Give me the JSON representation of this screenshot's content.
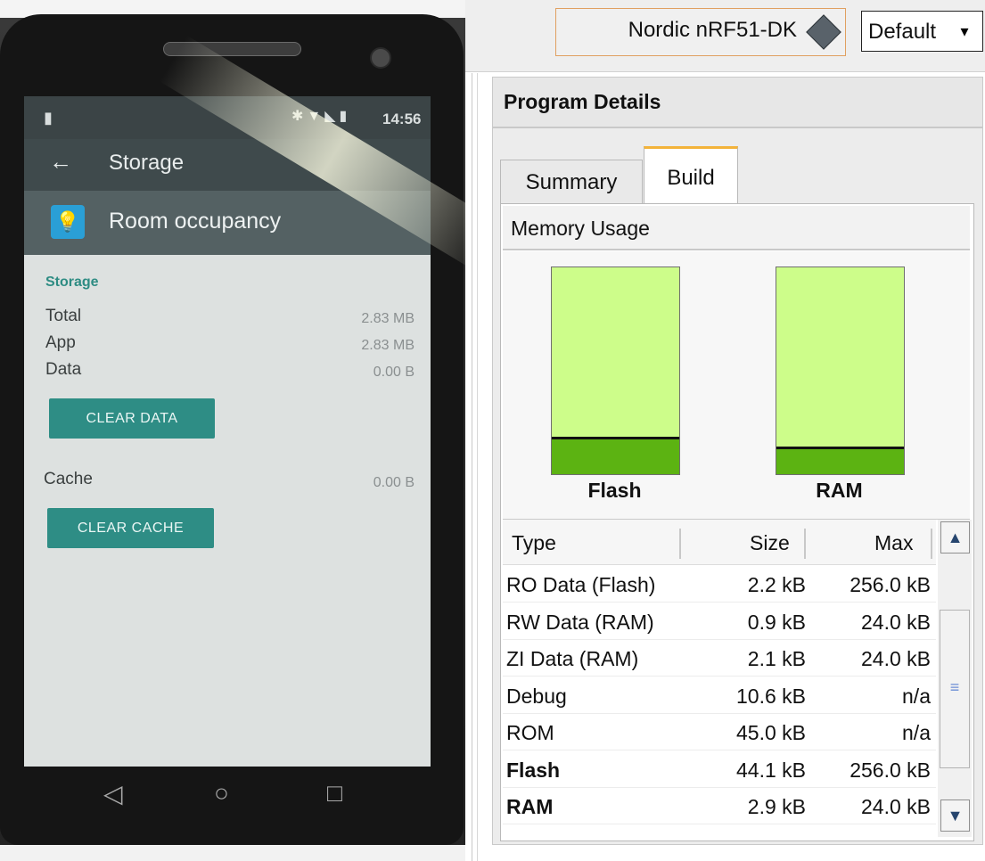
{
  "phone": {
    "status_time": "14:56",
    "toolbar_title": "Storage",
    "app_name": "Room occupancy",
    "section_title": "Storage",
    "rows": [
      {
        "label": "Total",
        "value": "2.83 MB"
      },
      {
        "label": "App",
        "value": "2.83 MB"
      },
      {
        "label": "Data",
        "value": "0.00 B"
      }
    ],
    "clear_data_label": "CLEAR DATA",
    "cache_label": "Cache",
    "cache_value": "0.00 B",
    "clear_cache_label": "CLEAR CACHE",
    "nav": {
      "back": "◁",
      "home": "○",
      "recents": "□"
    },
    "icons": {
      "back_arrow": "←",
      "bulb": "💡"
    }
  },
  "toolbar": {
    "device_label": "Nordic nRF51-DK",
    "config_label": "Default",
    "dropdown_arrow": "▾"
  },
  "program_details": {
    "title": "Program Details",
    "tabs": [
      {
        "label": "Summary",
        "active": false
      },
      {
        "label": "Build",
        "active": true
      }
    ],
    "memory_usage_label": "Memory Usage",
    "bars": [
      {
        "label": "Flash",
        "used_fraction": 0.17
      },
      {
        "label": "RAM",
        "used_fraction": 0.12
      }
    ],
    "table": {
      "headers": [
        "Type",
        "Size",
        "Max"
      ],
      "rows": [
        {
          "type": "RO Data (Flash)",
          "size": "2.2 kB",
          "max": "256.0 kB",
          "bold": false
        },
        {
          "type": "RW Data (RAM)",
          "size": "0.9 kB",
          "max": "24.0 kB",
          "bold": false
        },
        {
          "type": "ZI Data (RAM)",
          "size": "2.1 kB",
          "max": "24.0 kB",
          "bold": false
        },
        {
          "type": "Debug",
          "size": "10.6 kB",
          "max": "n/a",
          "bold": false
        },
        {
          "type": "ROM",
          "size": "45.0 kB",
          "max": "n/a",
          "bold": false
        },
        {
          "type": "Flash",
          "size": "44.1 kB",
          "max": "256.0 kB",
          "bold": true
        },
        {
          "type": "RAM",
          "size": "2.9 kB",
          "max": "24.0 kB",
          "bold": true
        }
      ]
    },
    "scroll_icons": {
      "up": "▲",
      "down": "▼",
      "grip": "≡"
    }
  },
  "colors": {
    "android_teal": "#2e8d85",
    "bar_free": "#cdfd8a",
    "bar_used": "#5cb312",
    "tab_accent": "#f3b33a",
    "device_border": "#e0a060"
  }
}
